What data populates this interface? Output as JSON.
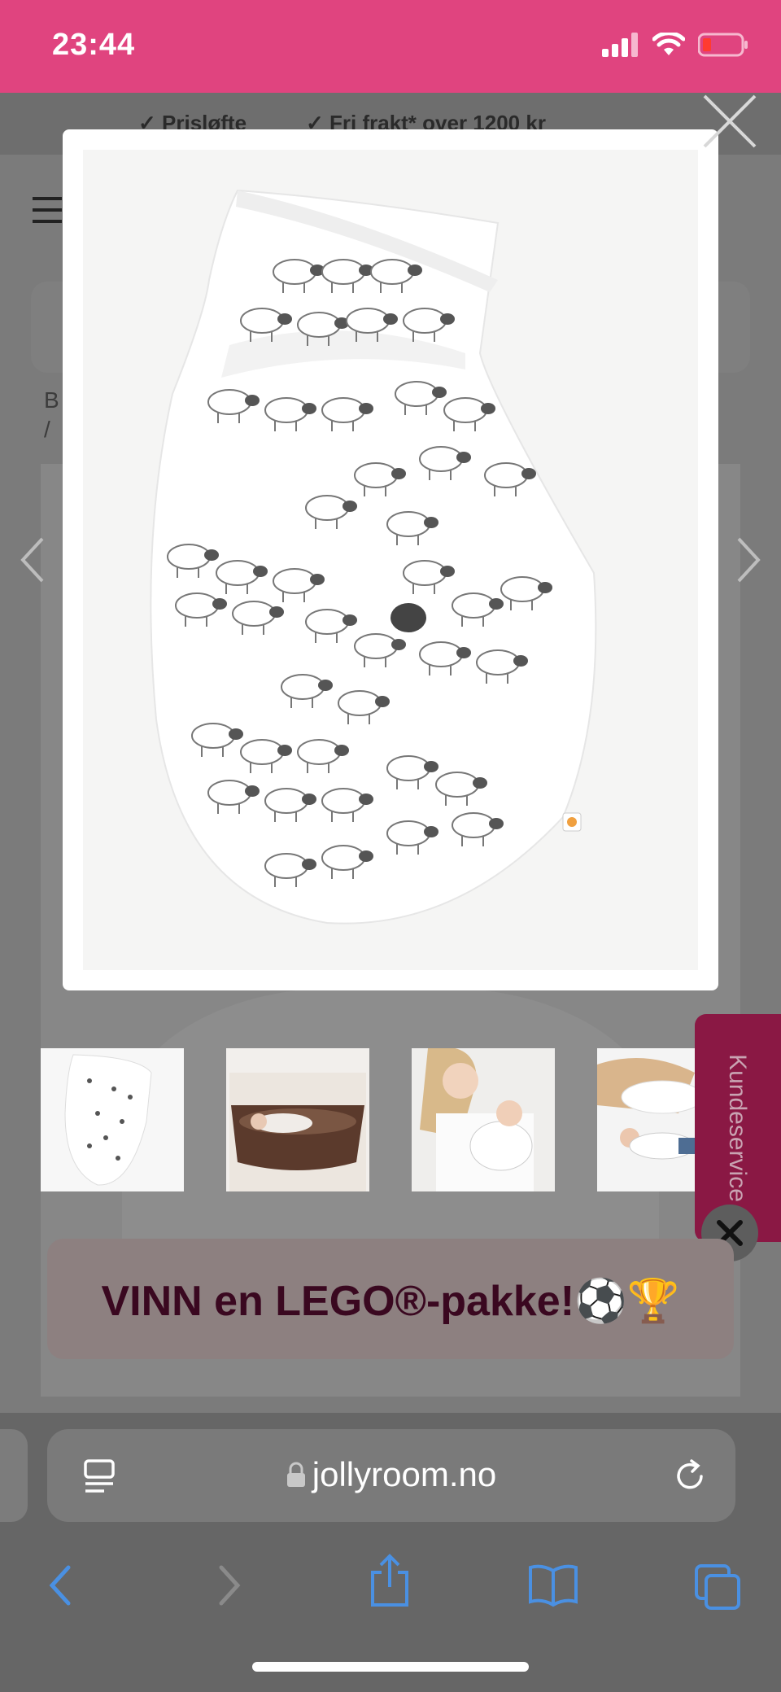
{
  "status_bar": {
    "time": "23:44"
  },
  "page": {
    "promo_items": [
      "✓ Prisløfte",
      "✓ Fri frakt* over 1200 kr"
    ],
    "breadcrumb_lines": [
      "B",
      "/"
    ],
    "contest_banner": "VINN en LEGO®-pakke!⚽🏆",
    "customer_service_tab": "Kundeservice"
  },
  "modal": {
    "image_alt": "Swaddle wrap with sheep print"
  },
  "thumbnails": [
    {
      "name": "thumb-swaddle-product"
    },
    {
      "name": "thumb-baby-in-bowl"
    },
    {
      "name": "thumb-mother-holding-baby"
    },
    {
      "name": "thumb-mother-and-baby-on-bed"
    }
  ],
  "browser": {
    "url": "jollyroom.no"
  },
  "colors": {
    "status_bar": "#e0447f",
    "accent_blue": "#4a90e2",
    "customer_service": "#8a1844"
  }
}
